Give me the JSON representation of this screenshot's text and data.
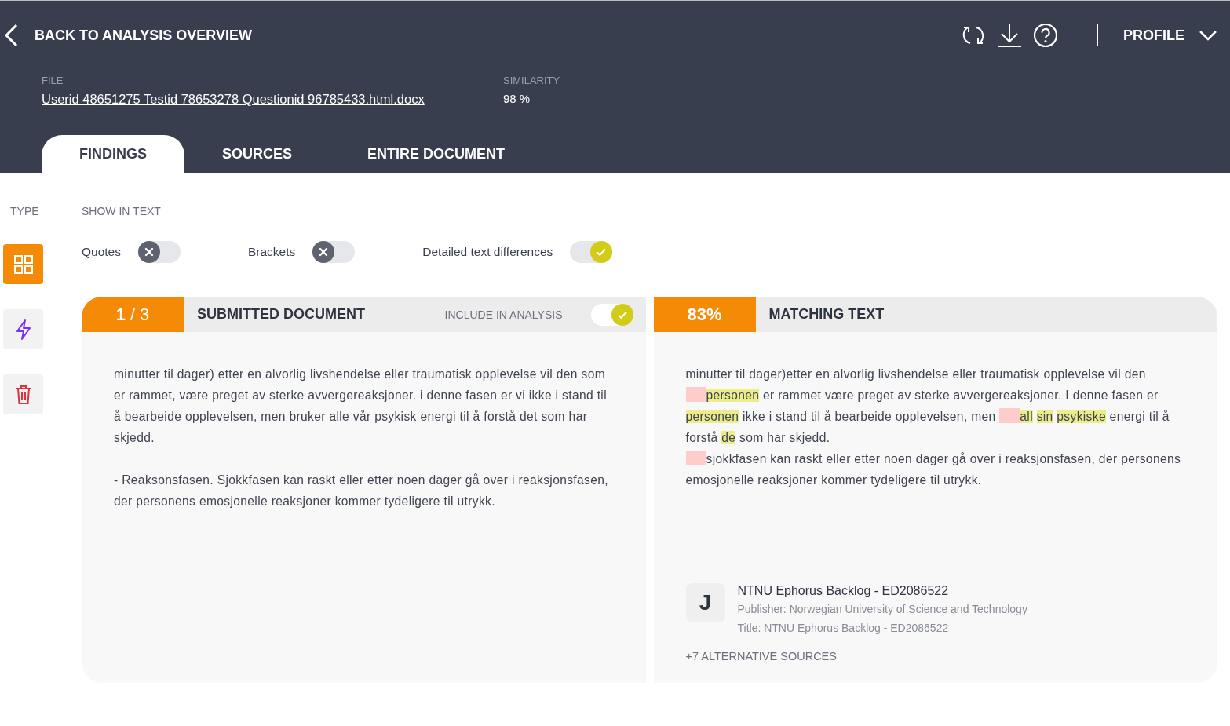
{
  "header": {
    "back_label": "BACK TO ANALYSIS OVERVIEW",
    "profile_label": "PROFILE",
    "file_label": "FILE",
    "file_name": "Userid 48651275 Testid 78653278 Questionid 96785433.html.docx",
    "similarity_label": "SIMILARITY",
    "similarity_value": "98 %"
  },
  "tabs": [
    {
      "label": "FINDINGS",
      "selected": true
    },
    {
      "label": "SOURCES",
      "selected": false
    },
    {
      "label": "ENTIRE DOCUMENT",
      "selected": false
    }
  ],
  "type_rail": {
    "label": "TYPE",
    "items": [
      {
        "kind": "grid",
        "selected": true
      },
      {
        "kind": "bolt",
        "selected": false
      },
      {
        "kind": "trash",
        "selected": false
      }
    ]
  },
  "show_in_text": {
    "label": "SHOW IN TEXT",
    "toggles": [
      {
        "label": "Quotes",
        "on": false
      },
      {
        "label": "Brackets",
        "on": false
      },
      {
        "label": "Detailed text differences",
        "on": true
      }
    ]
  },
  "submitted": {
    "index": "1",
    "total": "/ 3",
    "title": "SUBMITTED DOCUMENT",
    "include_label": "INCLUDE IN ANALYSIS",
    "include_on": true,
    "paragraphs": [
      "minutter til dager) etter en alvorlig livshendelse eller traumatisk opplevelse vil den som er rammet, være preget av sterke avvergereaksjoner. i denne fasen er vi ikke i stand til å bearbeide opplevelsen, men bruker alle vår psykisk energi til å forstå det som har skjedd.",
      "- Reaksonsfasen. Sjokkfasen kan raskt eller etter noen dager gå over i reaksjonsfasen, der personens emosjonelle reaksjoner kommer tydeligere til utrykk."
    ]
  },
  "matching": {
    "percent": "83%",
    "title": "MATCHING TEXT",
    "segments": [
      {
        "kind": "text",
        "text": "minutter til dager)etter en alvorlig livshendelse eller traumatisk opplevelse vil den "
      },
      {
        "kind": "gap"
      },
      {
        "kind": "match",
        "text": "personen"
      },
      {
        "kind": "text",
        "text": " er rammet være preget av sterke avvergereaksjoner. I denne fasen er "
      },
      {
        "kind": "match",
        "text": "personen"
      },
      {
        "kind": "text",
        "text": " ikke i stand til å bearbeide opplevelsen, men "
      },
      {
        "kind": "gap"
      },
      {
        "kind": "match",
        "text": "all",
        "space_after": true
      },
      {
        "kind": "match",
        "text": "sin",
        "space_after": true
      },
      {
        "kind": "match",
        "text": "psykiske"
      },
      {
        "kind": "text",
        "text": " energi til å forstå "
      },
      {
        "kind": "match",
        "text": "de"
      },
      {
        "kind": "text",
        "text": " som har skjedd."
      },
      {
        "kind": "break"
      },
      {
        "kind": "gap"
      },
      {
        "kind": "text",
        "text": "sjokkfasen kan raskt eller etter noen dager gå over i reaksjonsfasen, der personens emosjonelle reaksjoner kommer tydeligere til utrykk."
      }
    ],
    "source": {
      "initial": "J",
      "name": "NTNU Ephorus Backlog - ED2086522",
      "publisher": "Publisher: Norwegian University of Science and Technology",
      "title": "Title: NTNU Ephorus Backlog - ED2086522"
    },
    "alternatives": "+7 ALTERNATIVE SOURCES"
  }
}
